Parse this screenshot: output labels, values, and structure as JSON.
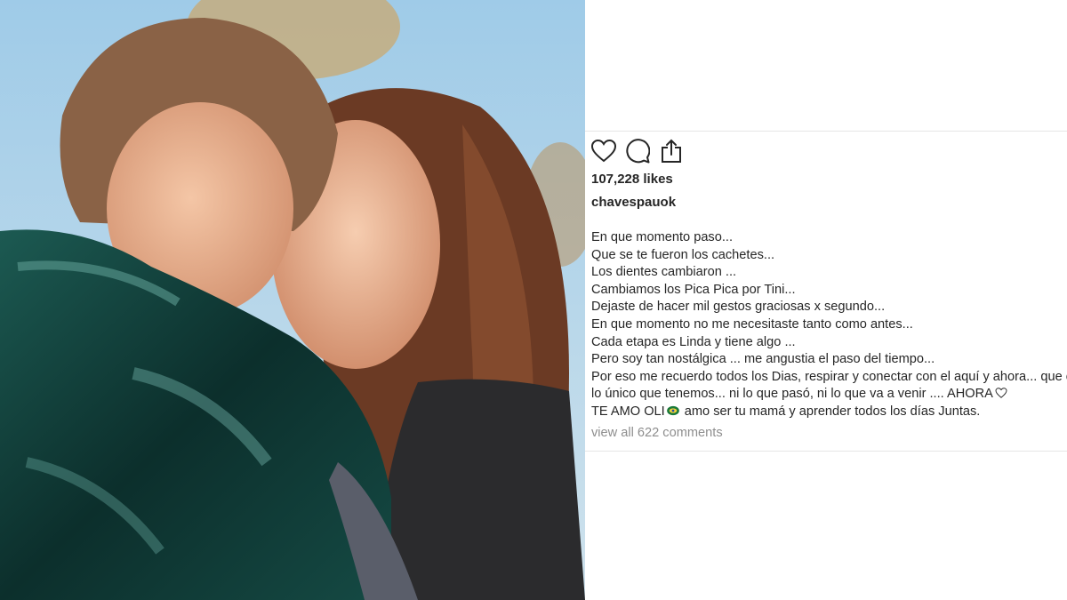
{
  "post": {
    "likes_label": "107,228 likes",
    "username": "chavespauok",
    "caption_lines": [
      "En que momento paso...",
      "Que se te fueron los cachetes...",
      "Los dientes cambiaron ...",
      "Cambiamos los Pica Pica por Tini...",
      "Dejaste de hacer mil gestos graciosas x segundo...",
      "En que momento no me necesitaste tanto como antes...",
      "Cada etapa es Linda y tiene algo ...",
      "Pero soy tan nostálgica ... me angustia el paso del tiempo...",
      "Por eso me recuerdo todos los Dias, respirar y conectar con el aquí y ahora... que es",
      "lo único que tenemos... ni lo que pasó, ni lo que va a venir .... AHORA",
      "TE AMO OLI",
      " amo ser tu mamá y aprender todos los días Juntas."
    ],
    "view_all_label": "view all 622 comments"
  },
  "icons": {
    "like": "heart-icon",
    "comment": "comment-icon",
    "share": "share-icon",
    "caption_heart": "white-heart-emoji",
    "caption_emoji": "green-heart-emoji"
  },
  "colors": {
    "text": "#262626",
    "muted": "#8e8e8e",
    "divider": "#e6e6e6",
    "jacket": "#0e3b37"
  }
}
